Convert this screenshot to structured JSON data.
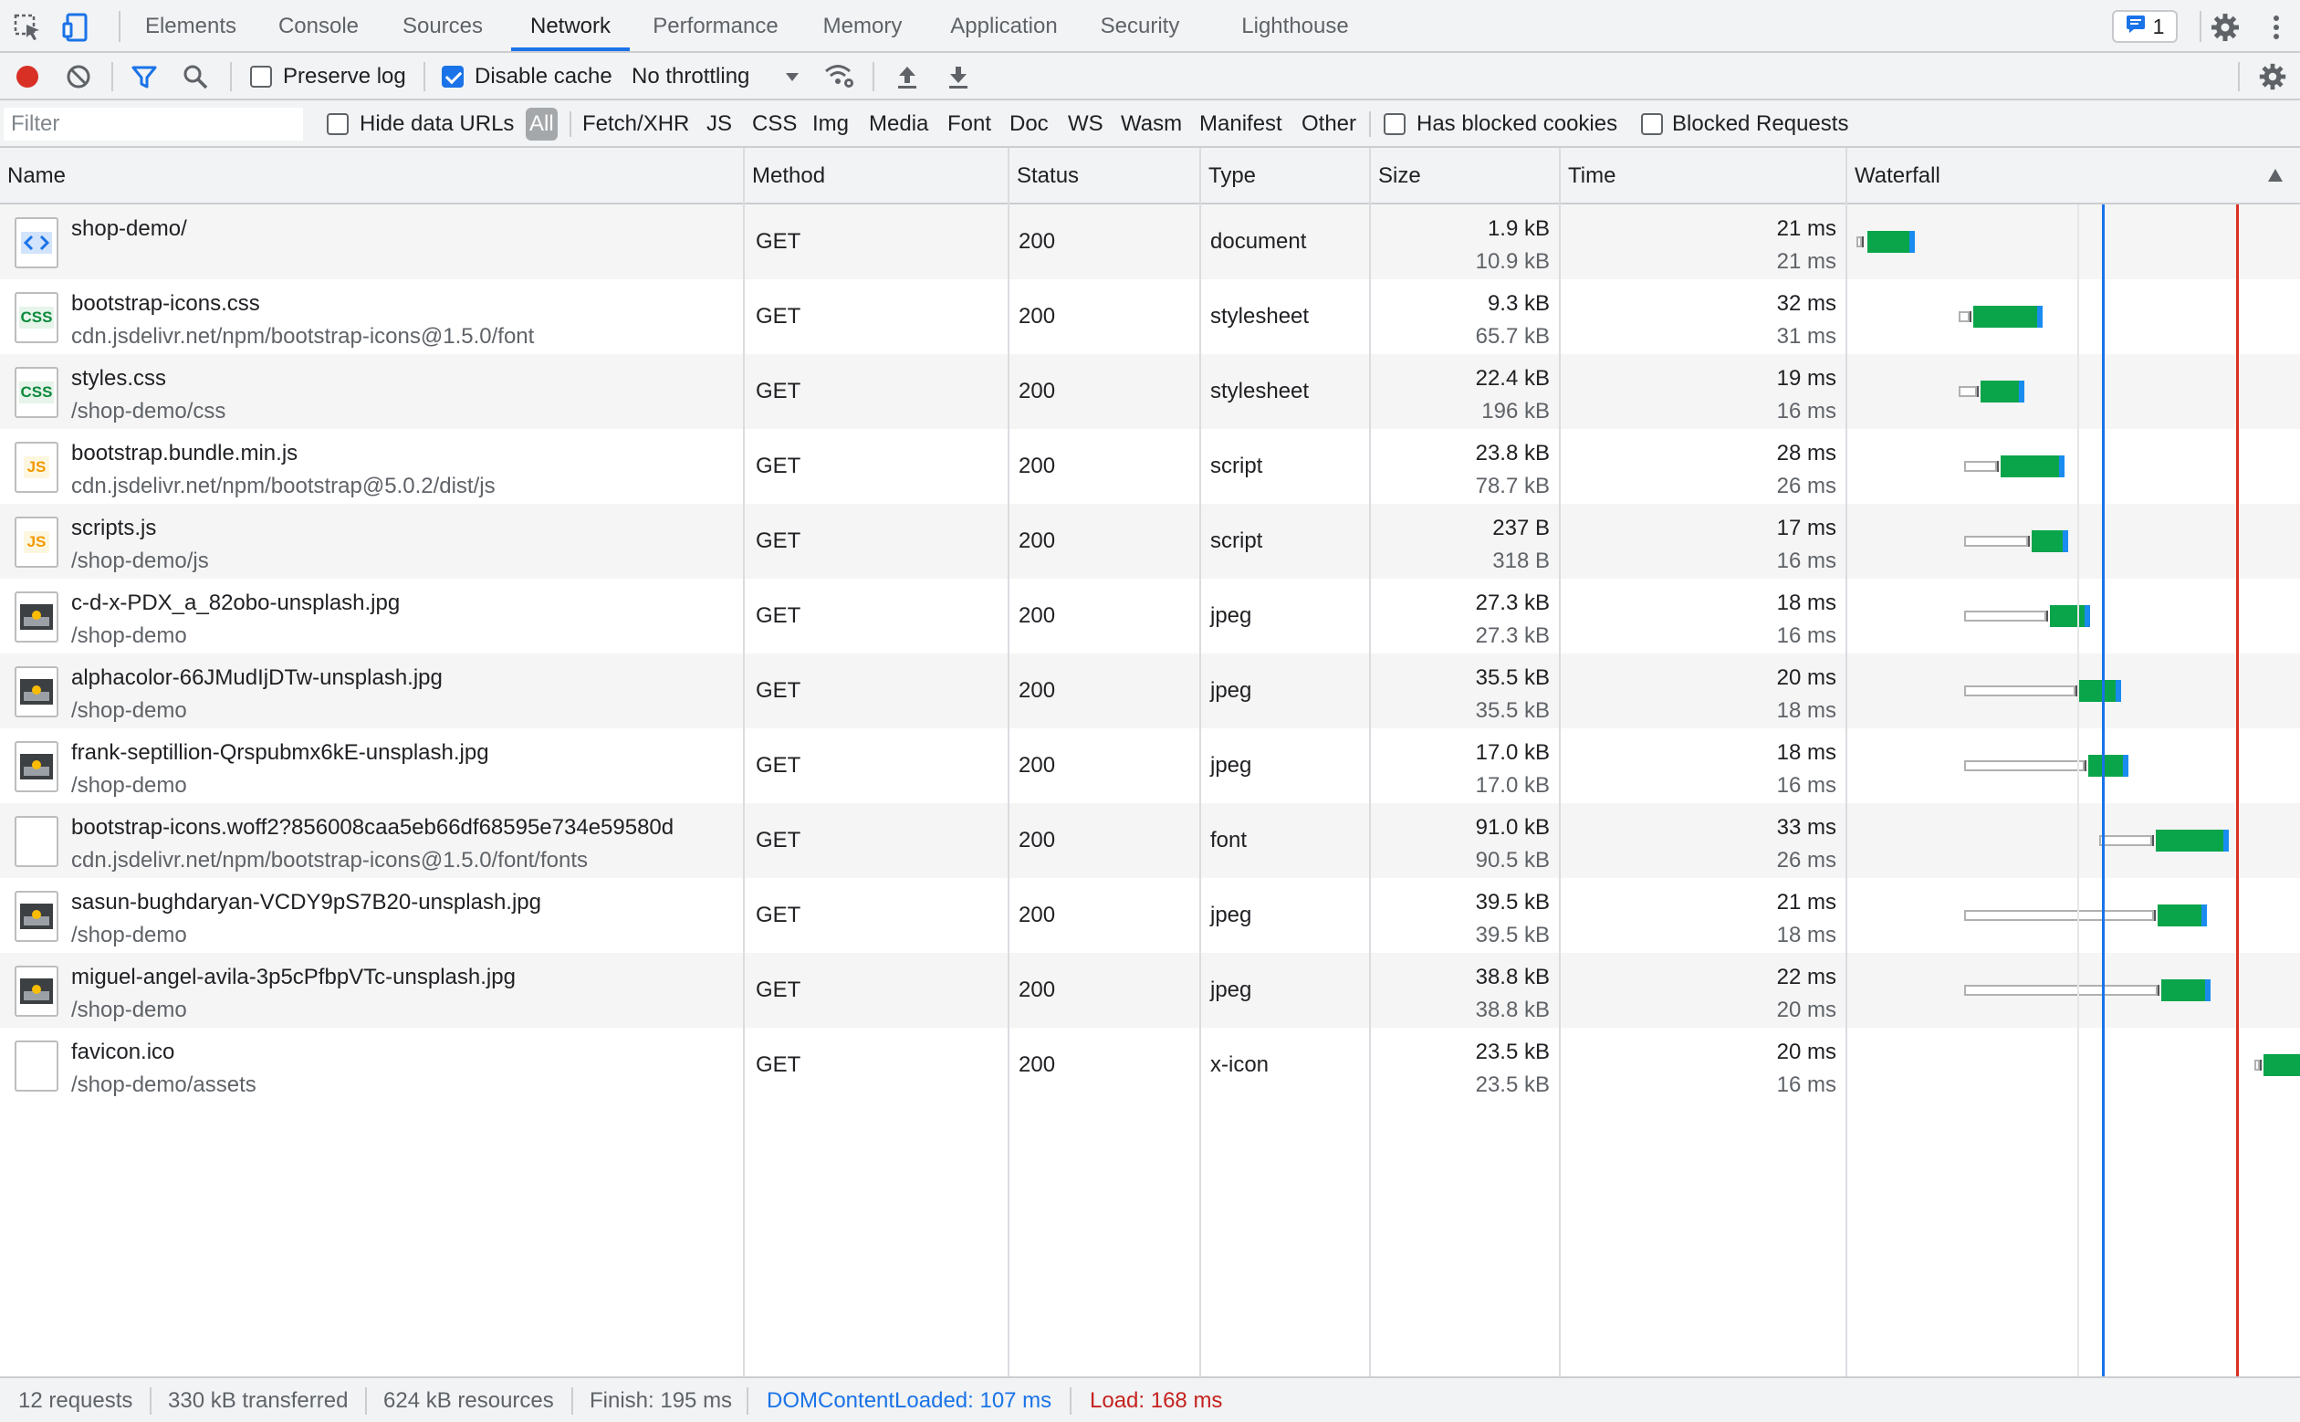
{
  "tabs": [
    {
      "label": "Elements",
      "active": false
    },
    {
      "label": "Console",
      "active": false
    },
    {
      "label": "Sources",
      "active": false
    },
    {
      "label": "Network",
      "active": true
    },
    {
      "label": "Performance",
      "active": false
    },
    {
      "label": "Memory",
      "active": false
    },
    {
      "label": "Application",
      "active": false
    },
    {
      "label": "Security",
      "active": false
    },
    {
      "label": "Lighthouse",
      "active": false
    }
  ],
  "issues_count": "1",
  "toolbar": {
    "preserve_log_label": "Preserve log",
    "preserve_log_checked": false,
    "disable_cache_label": "Disable cache",
    "disable_cache_checked": true,
    "throttling_value": "No throttling"
  },
  "filter": {
    "placeholder": "Filter",
    "hide_data_urls_label": "Hide data URLs",
    "types": [
      "All",
      "Fetch/XHR",
      "JS",
      "CSS",
      "Img",
      "Media",
      "Font",
      "Doc",
      "WS",
      "Wasm",
      "Manifest",
      "Other"
    ],
    "active_type": "All",
    "has_blocked_cookies_label": "Has blocked cookies",
    "blocked_requests_label": "Blocked Requests"
  },
  "columns": {
    "name": "Name",
    "method": "Method",
    "status": "Status",
    "type": "Type",
    "size": "Size",
    "time": "Time",
    "waterfall": "Waterfall"
  },
  "requests": [
    {
      "name": "shop-demo/",
      "path": "",
      "method": "GET",
      "status": "200",
      "type": "document",
      "size_transferred": "1.9 kB",
      "size_resource": "10.9 kB",
      "time_total": "21 ms",
      "time_latency": "21 ms",
      "icon": "html-document-icon"
    },
    {
      "name": "bootstrap-icons.css",
      "path": "cdn.jsdelivr.net/npm/bootstrap-icons@1.5.0/font",
      "method": "GET",
      "status": "200",
      "type": "stylesheet",
      "size_transferred": "9.3 kB",
      "size_resource": "65.7 kB",
      "time_total": "32 ms",
      "time_latency": "31 ms",
      "icon": "css-file-icon"
    },
    {
      "name": "styles.css",
      "path": "/shop-demo/css",
      "method": "GET",
      "status": "200",
      "type": "stylesheet",
      "size_transferred": "22.4 kB",
      "size_resource": "196 kB",
      "time_total": "19 ms",
      "time_latency": "16 ms",
      "icon": "css-file-icon"
    },
    {
      "name": "bootstrap.bundle.min.js",
      "path": "cdn.jsdelivr.net/npm/bootstrap@5.0.2/dist/js",
      "method": "GET",
      "status": "200",
      "type": "script",
      "size_transferred": "23.8 kB",
      "size_resource": "78.7 kB",
      "time_total": "28 ms",
      "time_latency": "26 ms",
      "icon": "js-file-icon"
    },
    {
      "name": "scripts.js",
      "path": "/shop-demo/js",
      "method": "GET",
      "status": "200",
      "type": "script",
      "size_transferred": "237 B",
      "size_resource": "318 B",
      "time_total": "17 ms",
      "time_latency": "16 ms",
      "icon": "js-file-icon"
    },
    {
      "name": "c-d-x-PDX_a_82obo-unsplash.jpg",
      "path": "/shop-demo",
      "method": "GET",
      "status": "200",
      "type": "jpeg",
      "size_transferred": "27.3 kB",
      "size_resource": "27.3 kB",
      "time_total": "18 ms",
      "time_latency": "16 ms",
      "icon": "image-thumbnail-icon"
    },
    {
      "name": "alphacolor-66JMudIjDTw-unsplash.jpg",
      "path": "/shop-demo",
      "method": "GET",
      "status": "200",
      "type": "jpeg",
      "size_transferred": "35.5 kB",
      "size_resource": "35.5 kB",
      "time_total": "20 ms",
      "time_latency": "18 ms",
      "icon": "image-thumbnail-icon"
    },
    {
      "name": "frank-septillion-Qrspubmx6kE-unsplash.jpg",
      "path": "/shop-demo",
      "method": "GET",
      "status": "200",
      "type": "jpeg",
      "size_transferred": "17.0 kB",
      "size_resource": "17.0 kB",
      "time_total": "18 ms",
      "time_latency": "16 ms",
      "icon": "image-thumbnail-icon"
    },
    {
      "name": "bootstrap-icons.woff2?856008caa5eb66df68595e734e59580d",
      "path": "cdn.jsdelivr.net/npm/bootstrap-icons@1.5.0/font/fonts",
      "method": "GET",
      "status": "200",
      "type": "font",
      "size_transferred": "91.0 kB",
      "size_resource": "90.5 kB",
      "time_total": "33 ms",
      "time_latency": "26 ms",
      "icon": "blank-file-icon"
    },
    {
      "name": "sasun-bughdaryan-VCDY9pS7B20-unsplash.jpg",
      "path": "/shop-demo",
      "method": "GET",
      "status": "200",
      "type": "jpeg",
      "size_transferred": "39.5 kB",
      "size_resource": "39.5 kB",
      "time_total": "21 ms",
      "time_latency": "18 ms",
      "icon": "image-thumbnail-icon"
    },
    {
      "name": "miguel-angel-avila-3p5cPfbpVTc-unsplash.jpg",
      "path": "/shop-demo",
      "method": "GET",
      "status": "200",
      "type": "jpeg",
      "size_transferred": "38.8 kB",
      "size_resource": "38.8 kB",
      "time_total": "22 ms",
      "time_latency": "20 ms",
      "icon": "image-thumbnail-icon"
    },
    {
      "name": "favicon.ico",
      "path": "/shop-demo/assets",
      "method": "GET",
      "status": "200",
      "type": "x-icon",
      "size_transferred": "23.5 kB",
      "size_resource": "23.5 kB",
      "time_total": "20 ms",
      "time_latency": "16 ms",
      "icon": "blank-file-icon"
    }
  ],
  "status_bar": {
    "requests": "12 requests",
    "transferred": "330 kB transferred",
    "resources": "624 kB resources",
    "finish": "Finish: 195 ms",
    "dom_content_loaded": "DOMContentLoaded: 107 ms",
    "load": "Load: 168 ms"
  },
  "colors": {
    "accent": "#1a73e8",
    "record_red": "#d93025",
    "waterfall_green": "#0aa54a",
    "waterfall_blue": "#1a8cf0"
  }
}
